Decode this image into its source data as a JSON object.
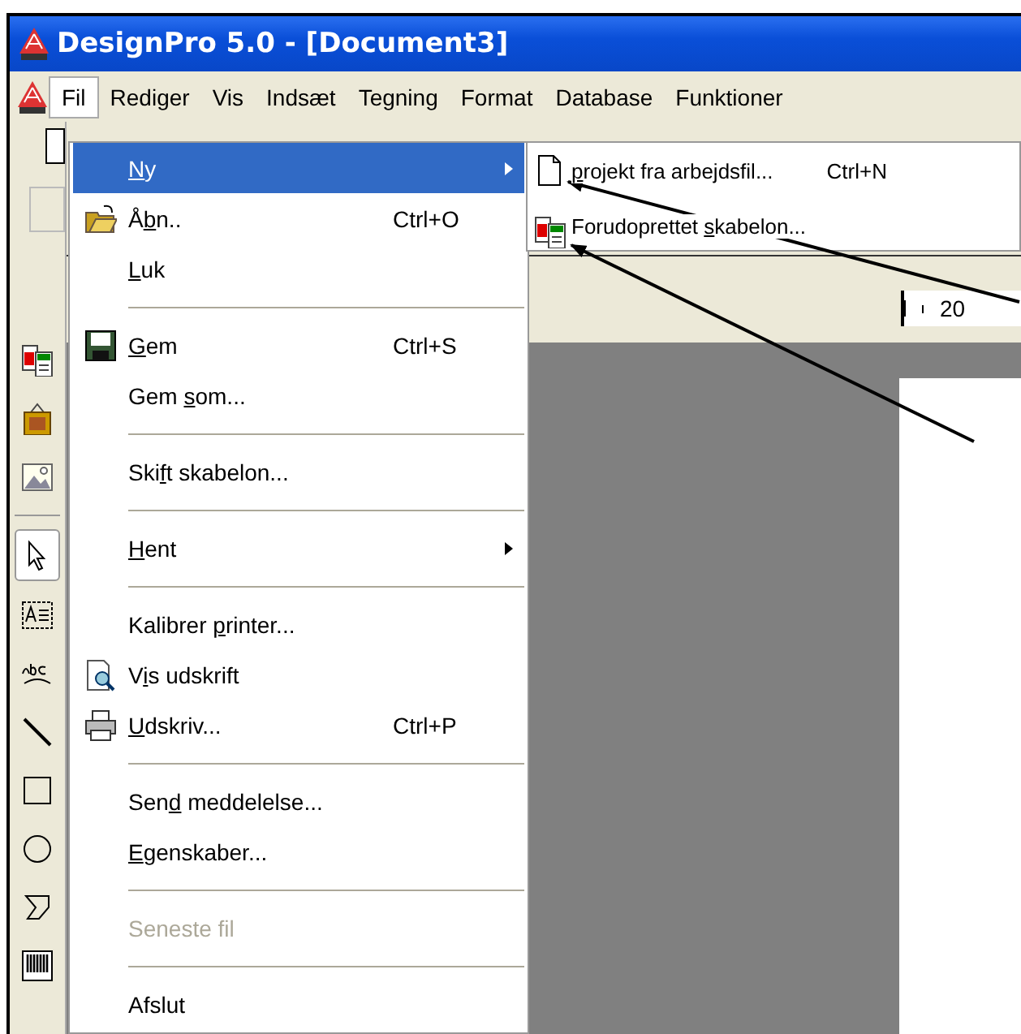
{
  "window": {
    "title": "DesignPro 5.0 - [Document3]"
  },
  "menubar": [
    {
      "label": "Fil",
      "selected": true
    },
    {
      "label": "Rediger",
      "selected": false
    },
    {
      "label": "Vis",
      "selected": false
    },
    {
      "label": "Indsæt",
      "selected": false
    },
    {
      "label": "Tegning",
      "selected": false
    },
    {
      "label": "Format",
      "selected": false
    },
    {
      "label": "Database",
      "selected": false
    },
    {
      "label": "Funktioner",
      "selected": false
    }
  ],
  "tools": [
    {
      "selected": false
    },
    {
      "selected": false
    },
    {
      "selected": false
    },
    {
      "selected": true
    },
    {
      "selected": false
    },
    {
      "selected": false
    },
    {
      "selected": false
    },
    {
      "selected": false
    },
    {
      "selected": false
    },
    {
      "selected": false
    },
    {
      "selected": false
    }
  ],
  "file_menu": [
    {
      "kind": "item",
      "key": "N",
      "after": "y",
      "submenu": true,
      "selected": true,
      "disabled": false
    },
    {
      "kind": "item",
      "before": "Å",
      "key": "b",
      "after": "n..",
      "shortcut": "Ctrl+O",
      "submenu": false,
      "selected": false,
      "disabled": false
    },
    {
      "kind": "item",
      "key": "L",
      "after": "uk",
      "submenu": false,
      "selected": false,
      "disabled": false
    },
    {
      "kind": "separator"
    },
    {
      "kind": "item",
      "key": "G",
      "after": "em",
      "shortcut": "Ctrl+S",
      "submenu": false,
      "selected": false,
      "disabled": false
    },
    {
      "kind": "item",
      "before": "Gem ",
      "key": "s",
      "after": "om...",
      "submenu": false,
      "selected": false,
      "disabled": false
    },
    {
      "kind": "separator"
    },
    {
      "kind": "item",
      "before": "Ski",
      "key": "f",
      "after": "t skabelon...",
      "submenu": false,
      "selected": false,
      "disabled": false
    },
    {
      "kind": "separator"
    },
    {
      "kind": "item",
      "key": "H",
      "after": "ent",
      "submenu": true,
      "selected": false,
      "disabled": false
    },
    {
      "kind": "separator"
    },
    {
      "kind": "item",
      "before": "Kalibrer ",
      "key": "p",
      "after": "rinter...",
      "submenu": false,
      "selected": false,
      "disabled": false
    },
    {
      "kind": "item",
      "before": "V",
      "key": "i",
      "after": "s udskrift",
      "submenu": false,
      "selected": false,
      "disabled": false
    },
    {
      "kind": "item",
      "key": "U",
      "after": "dskriv...",
      "shortcut": "Ctrl+P",
      "submenu": false,
      "selected": false,
      "disabled": false
    },
    {
      "kind": "separator"
    },
    {
      "kind": "item",
      "before": "Sen",
      "key": "d",
      "after": " meddelelse...",
      "submenu": false,
      "selected": false,
      "disabled": false
    },
    {
      "kind": "item",
      "key": "E",
      "after": "genskaber...",
      "submenu": false,
      "selected": false,
      "disabled": false
    },
    {
      "kind": "separator"
    },
    {
      "kind": "item",
      "before": "Seneste fil",
      "submenu": false,
      "selected": false,
      "disabled": true
    },
    {
      "kind": "separator"
    },
    {
      "kind": "item",
      "before": "Afslut",
      "submenu": false,
      "selected": false,
      "disabled": false
    }
  ],
  "new_submenu": [
    {
      "key": "p",
      "after": "rojekt fra arbejdsfil...",
      "shortcut": "Ctrl+N"
    },
    {
      "before": "Forudoprettet ",
      "key": "s",
      "after": "kabelon..."
    }
  ],
  "ruler": {
    "reading": "20"
  }
}
